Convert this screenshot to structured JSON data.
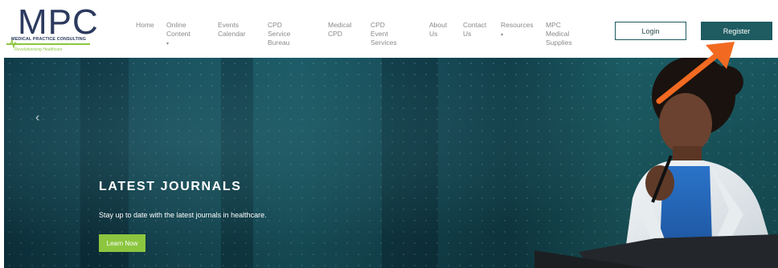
{
  "logo": {
    "text": "MPC",
    "subtitle": "MEDICAL PRACTICE CONSULTING",
    "tagline": "Revolutionising Healthcare"
  },
  "nav": {
    "items": [
      {
        "line1": "Home",
        "line2": ""
      },
      {
        "line1": "Online",
        "line2": "Content",
        "has_caret": true
      },
      {
        "line1": "Events",
        "line2": "Calendar"
      },
      {
        "line1": "CPD Service",
        "line2": "Bureau"
      },
      {
        "line1": "Medical",
        "line2": "CPD"
      },
      {
        "line1": "CPD Event",
        "line2": "Services"
      },
      {
        "line1": "About",
        "line2": "Us"
      },
      {
        "line1": "Contact",
        "line2": "Us"
      },
      {
        "line1": "Resources",
        "line2": "",
        "has_caret": true
      },
      {
        "line1": "MPC Medical",
        "line2": "Supplies"
      }
    ],
    "caret": "▾"
  },
  "auth": {
    "login_label": "Login",
    "register_label": "Register"
  },
  "hero": {
    "prev_glyph": "‹",
    "title": "LATEST JOURNALS",
    "text": "Stay up to date with the latest journals in healthcare.",
    "cta_label": "Learn Now"
  },
  "colors": {
    "brand_navy": "#2c3a5e",
    "brand_green": "#8cc63f",
    "teal": "#1e5c61",
    "annotation_arrow": "#f26a21"
  }
}
